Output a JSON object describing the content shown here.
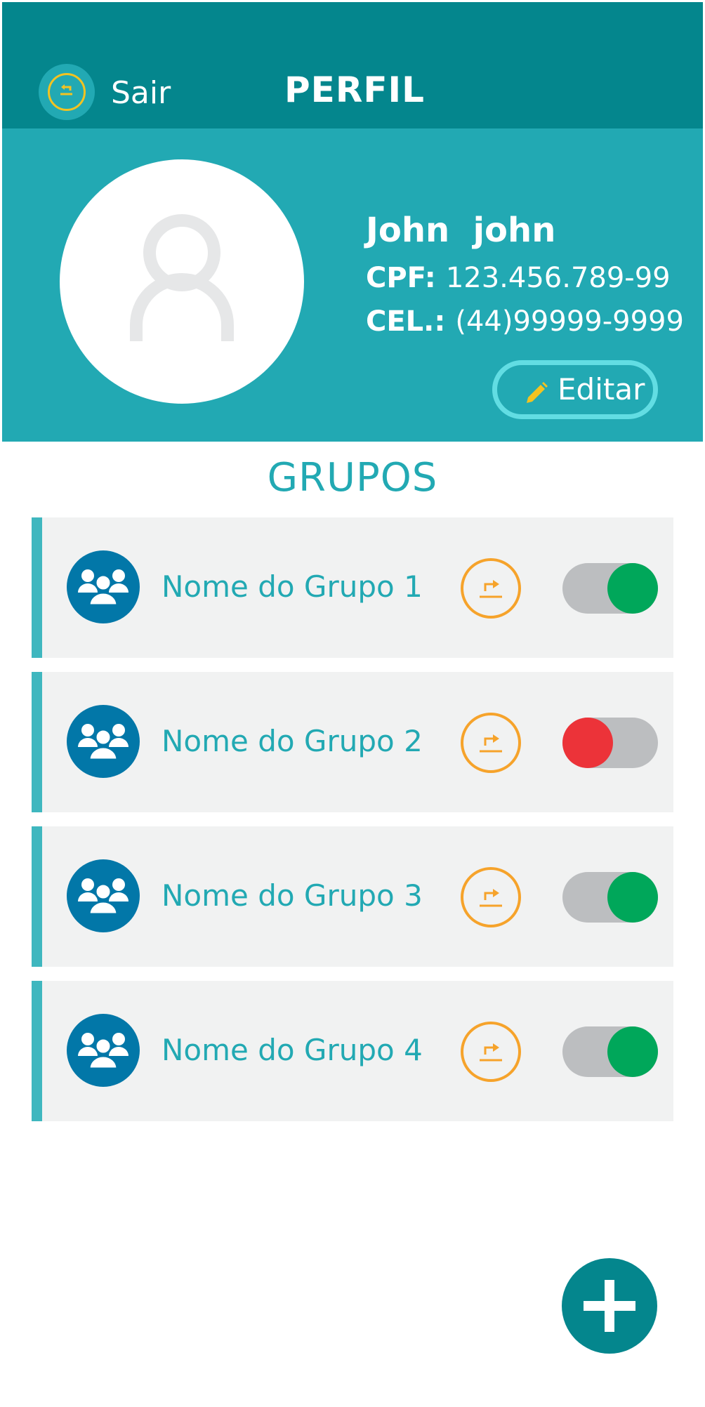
{
  "header": {
    "title": "PERFIL",
    "back_label": "Sair"
  },
  "profile": {
    "name": "John  john",
    "cpf_label": "CPF:",
    "cpf_value": "123.456.789-99",
    "cel_label": "CEL.:",
    "cel_value": "(44)99999-9999",
    "edit_label": "Editar"
  },
  "groups": {
    "title": "GRUPOS",
    "items": [
      {
        "name": "Nome do Grupo 1",
        "active": true
      },
      {
        "name": "Nome do Grupo 2",
        "active": false
      },
      {
        "name": "Nome do Grupo 3",
        "active": true
      },
      {
        "name": "Nome do Grupo 4",
        "active": true
      }
    ]
  },
  "icons": {
    "back": "back-arrow-icon",
    "avatar": "user-icon",
    "edit": "pencil-icon",
    "group": "group-users-icon",
    "share": "share-arrow-icon",
    "add": "plus-icon"
  },
  "colors": {
    "header": "#04868d",
    "profile_bg": "#22a9b3",
    "accent_yellow": "#f3c321",
    "share_orange": "#f6a32b",
    "group_avatar": "#0277a8",
    "toggle_on": "#00a75a",
    "toggle_off": "#ec3339"
  }
}
